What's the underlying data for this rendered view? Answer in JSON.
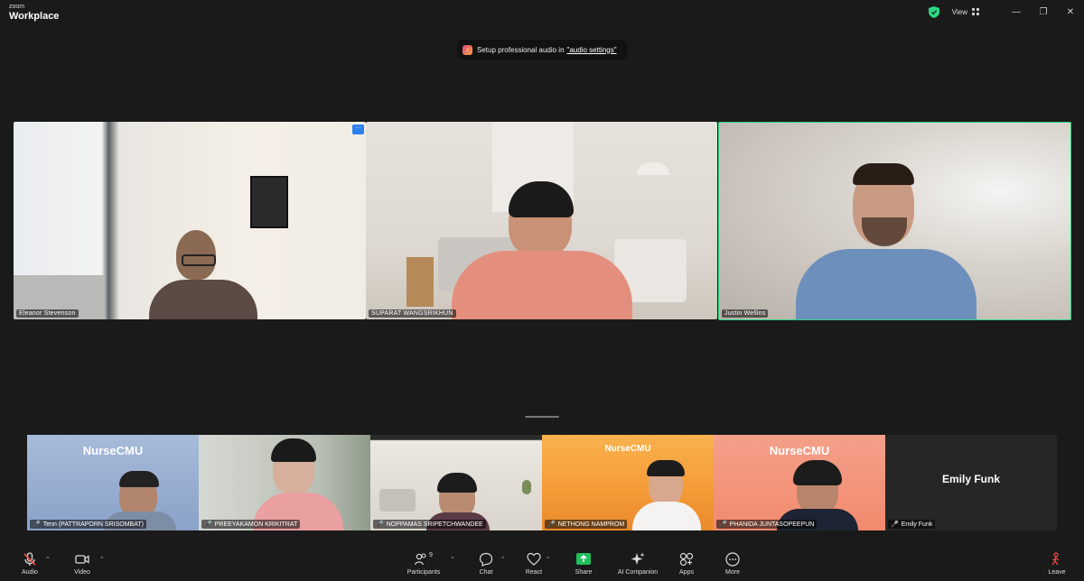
{
  "window": {
    "brand_small": "zoom",
    "brand_big": "Workplace",
    "view_label": "View",
    "minimize": "—",
    "maximize": "❐",
    "close": "✕"
  },
  "notice": {
    "text": "Setup professional audio in",
    "link": "\"audio settings\""
  },
  "main_tiles": [
    {
      "name": "Eleanor Stevenson"
    },
    {
      "name": "SUPARAT WANGSRIKHUN"
    },
    {
      "name": "Justin Wellins",
      "active_speaker": true
    }
  ],
  "gallery": [
    {
      "name": "Tenn (PATTRAPORN SRISOMBAT)",
      "muted": true,
      "logo": "NurseCMU"
    },
    {
      "name": "PREEYAKAMON KRIKITRAT",
      "muted": true
    },
    {
      "name": "NOPPAMAS SRIPETCHWANDEE",
      "muted": true
    },
    {
      "name": "NETHONG NAMPROM",
      "muted": true,
      "logo": "NurseCMU"
    },
    {
      "name": "PHANIDA JUNTASOPEEPUN",
      "muted": true,
      "logo": "NurseCMU"
    },
    {
      "name": "Emily Funk",
      "muted": true,
      "display_text": "Emily Funk"
    }
  ],
  "toolbar": {
    "audio": "Audio",
    "video": "Video",
    "participants": "Participants",
    "participants_count": "9",
    "chat": "Chat",
    "react": "React",
    "share": "Share",
    "ai_companion": "AI Companion",
    "apps": "Apps",
    "more": "More",
    "leave": "Leave"
  },
  "colors": {
    "active_speaker": "#2dd881",
    "share": "#21c05c",
    "muted": "#ff4a4a",
    "nursecmu_blue": "#9fb5d8",
    "nursecmu_orange": "#f7a13a"
  }
}
